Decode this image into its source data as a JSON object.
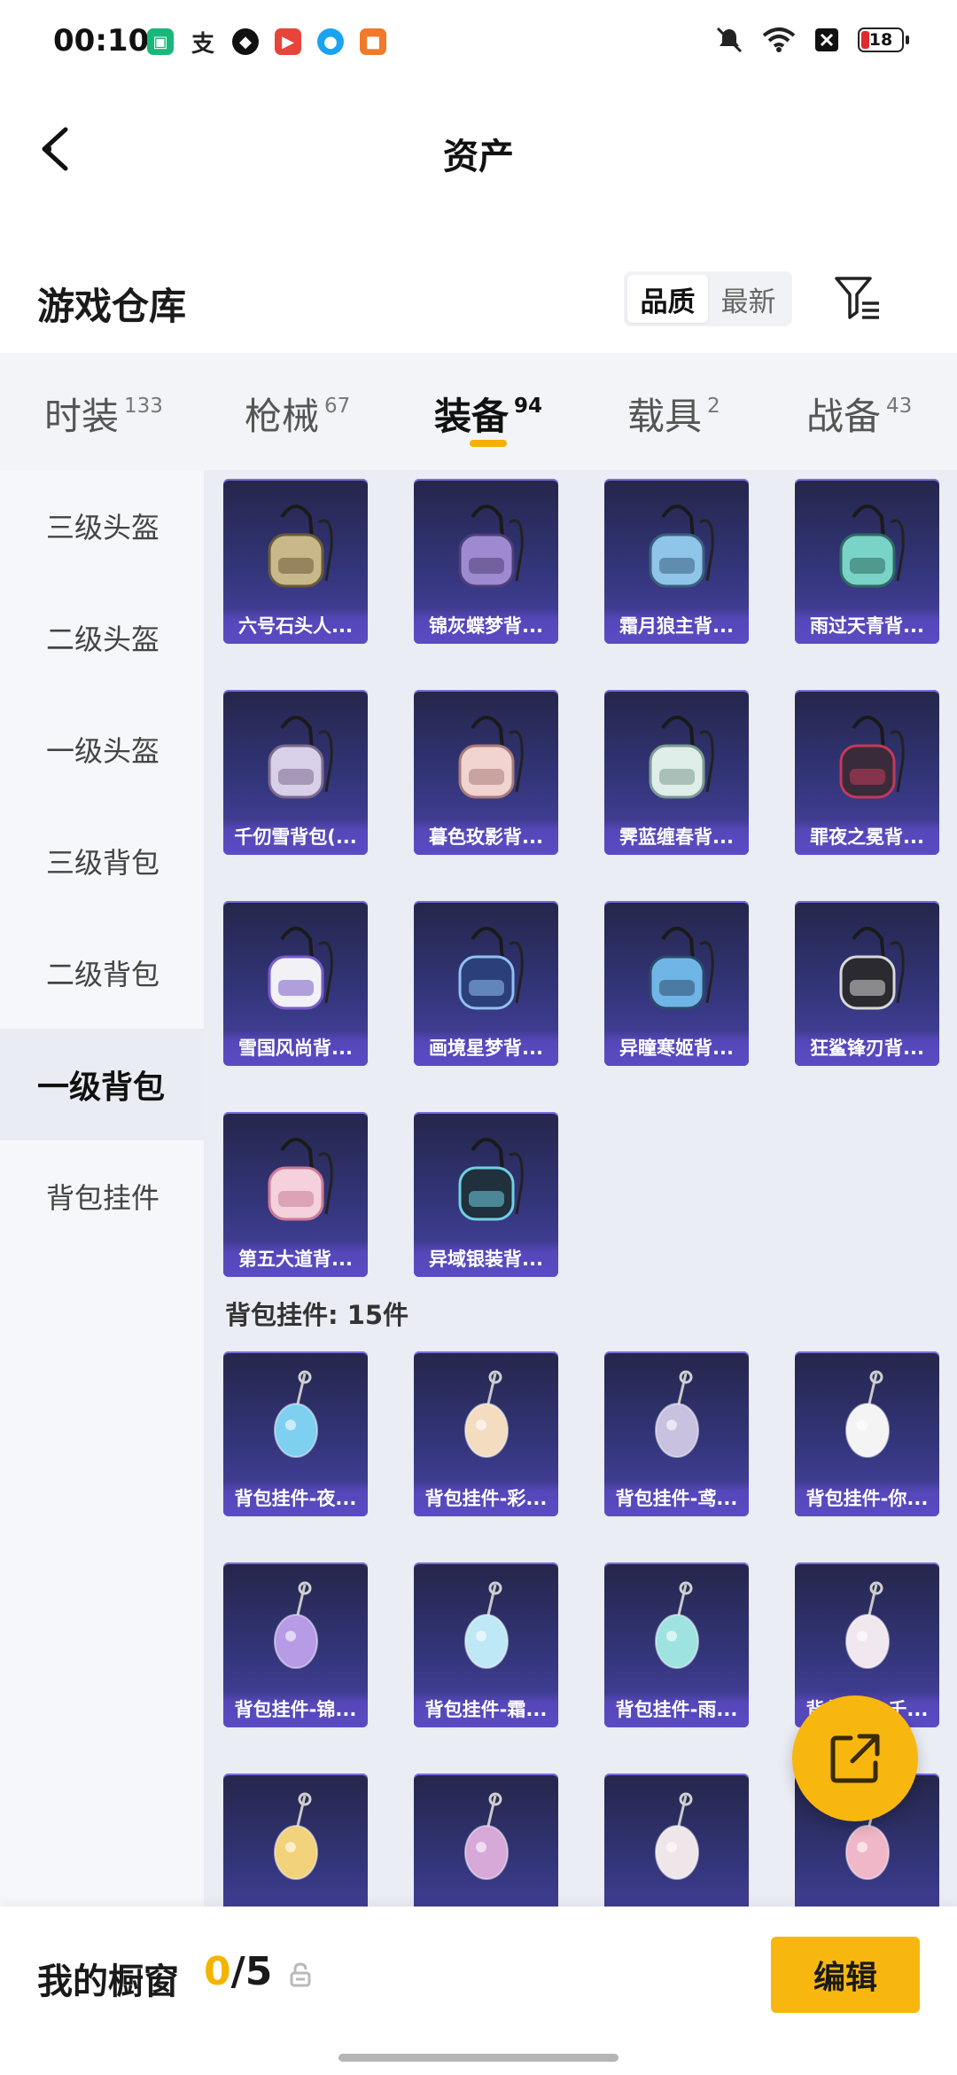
{
  "status": {
    "time": "00:10",
    "battery": "18",
    "app_icons": [
      "wallet-app-icon",
      "alipay-app-icon",
      "shield-app-icon",
      "video-app-icon",
      "qq-app-icon",
      "game-app-icon"
    ],
    "right_icons": [
      "mute-icon",
      "wifi-icon",
      "sim-x-icon"
    ]
  },
  "header": {
    "title": "资产"
  },
  "warehouse": {
    "title": "游戏仓库",
    "sort": {
      "quality": "品质",
      "latest": "最新",
      "active": "quality"
    }
  },
  "tabs": [
    {
      "label": "时装",
      "count": "133"
    },
    {
      "label": "枪械",
      "count": "67"
    },
    {
      "label": "装备",
      "count": "94"
    },
    {
      "label": "载具",
      "count": "2"
    },
    {
      "label": "战备",
      "count": "43"
    }
  ],
  "active_tab": 2,
  "sidebar": [
    {
      "label": "三级头盔"
    },
    {
      "label": "二级头盔"
    },
    {
      "label": "一级头盔"
    },
    {
      "label": "三级背包"
    },
    {
      "label": "二级背包"
    },
    {
      "label": "一级背包"
    },
    {
      "label": "背包挂件"
    }
  ],
  "active_side": 5,
  "backpacks": [
    {
      "label": "六号石头人...",
      "icon": "backpack-icon"
    },
    {
      "label": "锦灰蝶梦背...",
      "icon": "backpack-icon"
    },
    {
      "label": "霜月狼主背...",
      "icon": "backpack-icon"
    },
    {
      "label": "雨过天青背...",
      "icon": "backpack-icon"
    },
    {
      "label": "千仞雪背包(...",
      "icon": "backpack-icon"
    },
    {
      "label": "暮色玫影背...",
      "icon": "backpack-icon"
    },
    {
      "label": "霁蓝缠春背...",
      "icon": "backpack-icon"
    },
    {
      "label": "罪夜之冕背...",
      "icon": "backpack-icon"
    },
    {
      "label": "雪国风尚背...",
      "icon": "backpack-icon"
    },
    {
      "label": "画境星梦背...",
      "icon": "backpack-icon"
    },
    {
      "label": "异瞳寒姬背...",
      "icon": "backpack-icon"
    },
    {
      "label": "狂鲨锋刃背...",
      "icon": "backpack-icon"
    },
    {
      "label": "第五大道背...",
      "icon": "backpack-icon"
    },
    {
      "label": "异域银装背...",
      "icon": "backpack-icon"
    }
  ],
  "charms_section": "背包挂件: 15件",
  "charms": [
    {
      "label": "背包挂件-夜...",
      "icon": "charm-icon"
    },
    {
      "label": "背包挂件-彩...",
      "icon": "charm-icon"
    },
    {
      "label": "背包挂件-鸢...",
      "icon": "charm-icon"
    },
    {
      "label": "背包挂件-你...",
      "icon": "charm-icon"
    },
    {
      "label": "背包挂件-锦...",
      "icon": "charm-icon"
    },
    {
      "label": "背包挂件-霜...",
      "icon": "charm-icon"
    },
    {
      "label": "背包挂件-雨...",
      "icon": "charm-icon"
    },
    {
      "label": "背包挂件-千...",
      "icon": "charm-icon"
    },
    {
      "label": "",
      "icon": "charm-icon"
    },
    {
      "label": "",
      "icon": "charm-icon"
    },
    {
      "label": "",
      "icon": "charm-icon"
    },
    {
      "label": "",
      "icon": "charm-icon"
    }
  ],
  "bottom": {
    "label": "我的橱窗",
    "current": "0",
    "total": "/5",
    "edit": "编辑"
  },
  "colors": {
    "accent": "#f8b70f",
    "card": "#33357a"
  }
}
